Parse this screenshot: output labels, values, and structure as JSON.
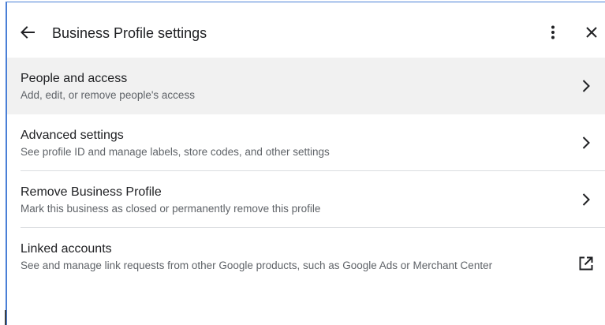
{
  "header": {
    "title": "Business Profile settings",
    "back_icon": "arrow-back-icon",
    "more_icon": "more-vert-icon",
    "close_icon": "close-icon"
  },
  "items": [
    {
      "title": "People and access",
      "subtitle": "Add, edit, or remove people's access",
      "icon": "chevron-right-icon",
      "highlighted": true
    },
    {
      "title": "Advanced settings",
      "subtitle": "See profile ID and manage labels, store codes, and other settings",
      "icon": "chevron-right-icon"
    },
    {
      "title": "Remove Business Profile",
      "subtitle": "Mark this business as closed or permanently remove this profile",
      "icon": "chevron-right-icon"
    },
    {
      "title": "Linked accounts",
      "subtitle": "See and manage link requests from other Google products, such as Google Ads or Merchant Center",
      "icon": "open-in-new-icon"
    }
  ],
  "colors": {
    "text_primary": "#202124",
    "text_secondary": "#5f6368",
    "divider": "#dadce0",
    "highlight_bg": "#f1f1f1",
    "window_border": "#4a7fd6"
  }
}
